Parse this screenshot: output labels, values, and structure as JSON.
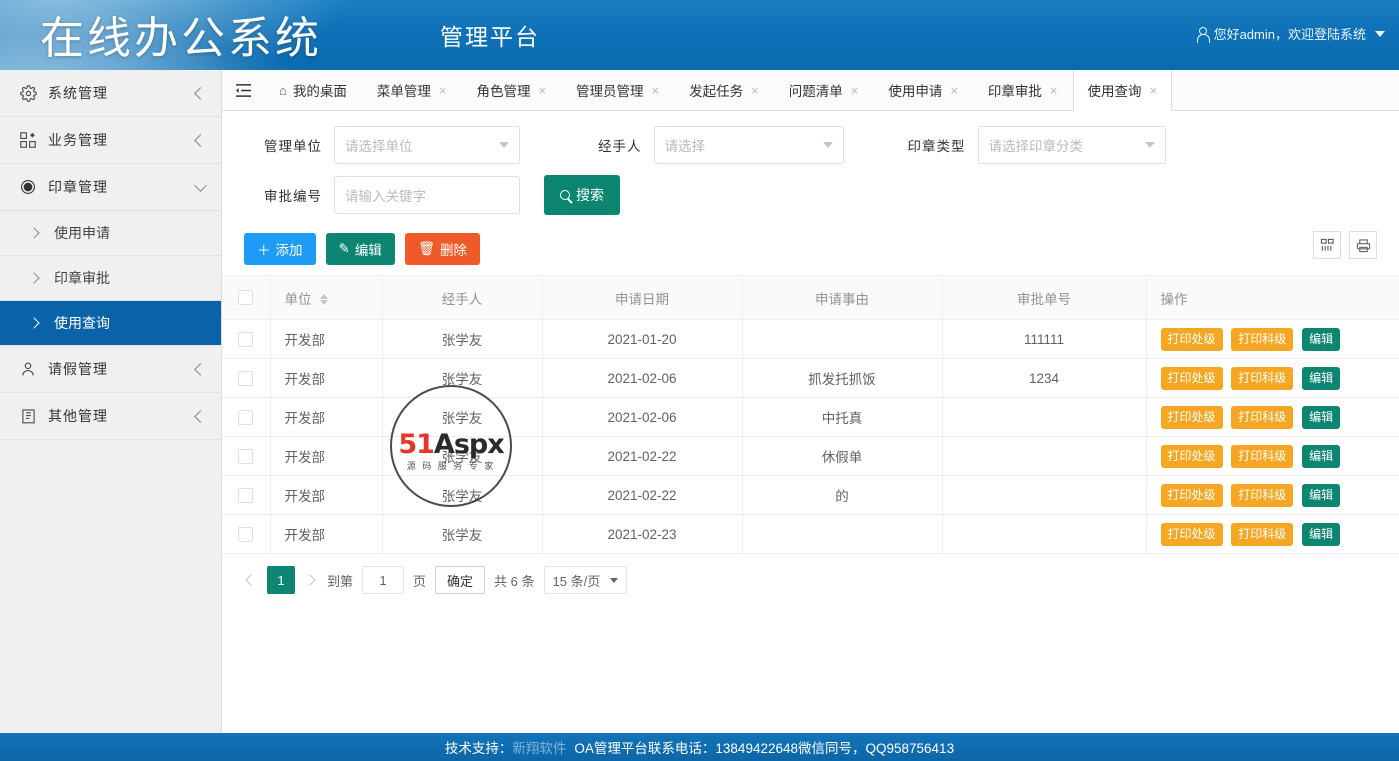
{
  "header": {
    "brand": "在线办公系统",
    "subtitle": "管理平台",
    "user_greeting": "您好admin，欢迎登陆系统",
    "user_icon": "user-icon",
    "caret_icon": "caret-down-icon"
  },
  "sidebar": {
    "items": [
      {
        "label": "系统管理",
        "icon": "gear-icon",
        "state": "collapsed"
      },
      {
        "label": "业务管理",
        "icon": "grid-icon",
        "state": "collapsed"
      },
      {
        "label": "印章管理",
        "icon": "circle-icon",
        "state": "expanded"
      }
    ],
    "sub_items": [
      {
        "label": "使用申请",
        "active": false
      },
      {
        "label": "印章审批",
        "active": false
      },
      {
        "label": "使用查询",
        "active": true
      }
    ],
    "items_after": [
      {
        "label": "请假管理",
        "icon": "person-icon",
        "state": "collapsed"
      },
      {
        "label": "其他管理",
        "icon": "clipboard-icon",
        "state": "collapsed"
      }
    ]
  },
  "tabs": {
    "toggle_icon": "menu-collapse-icon",
    "items": [
      {
        "label": "我的桌面",
        "icon": "home-icon",
        "closable": false,
        "active": false
      },
      {
        "label": "菜单管理",
        "closable": true,
        "active": false
      },
      {
        "label": "角色管理",
        "closable": true,
        "active": false
      },
      {
        "label": "管理员管理",
        "closable": true,
        "active": false
      },
      {
        "label": "发起任务",
        "closable": true,
        "active": false
      },
      {
        "label": "问题清单",
        "closable": true,
        "active": false
      },
      {
        "label": "使用申请",
        "closable": true,
        "active": false
      },
      {
        "label": "印章审批",
        "closable": true,
        "active": false
      },
      {
        "label": "使用查询",
        "closable": true,
        "active": true
      }
    ],
    "close_glyph": "×"
  },
  "search": {
    "unit_label": "管理单位",
    "unit_placeholder": "请选择单位",
    "handler_label": "经手人",
    "handler_placeholder": "请选择",
    "seal_type_label": "印章类型",
    "seal_type_placeholder": "请选择印章分类",
    "approval_no_label": "审批编号",
    "approval_no_placeholder": "请输入关键字",
    "search_button": "搜索",
    "search_icon": "search-icon"
  },
  "toolbar": {
    "add_label": "添加",
    "add_icon": "plus-icon",
    "edit_label": "编辑",
    "edit_icon": "pencil-icon",
    "delete_label": "删除",
    "delete_icon": "trash-icon",
    "columns_icon": "columns-icon",
    "print_icon": "printer-icon",
    "add_color": "#1e9bf5",
    "edit_color": "#0c8571",
    "delete_color": "#f05a28"
  },
  "table": {
    "columns": [
      "单位",
      "经手人",
      "申请日期",
      "申请事由",
      "审批单号",
      "操作"
    ],
    "sortable_column": "单位",
    "rows": [
      {
        "unit": "开发部",
        "handler": "张学友",
        "date": "2021-01-20",
        "reason": "",
        "approval_no": "111111"
      },
      {
        "unit": "开发部",
        "handler": "张学友",
        "date": "2021-02-06",
        "reason": "抓发托抓饭",
        "approval_no": "1234"
      },
      {
        "unit": "开发部",
        "handler": "张学友",
        "date": "2021-02-06",
        "reason": "中托真",
        "approval_no": ""
      },
      {
        "unit": "开发部",
        "handler": "张学友",
        "date": "2021-02-22",
        "reason": "休假单",
        "approval_no": ""
      },
      {
        "unit": "开发部",
        "handler": "张学友",
        "date": "2021-02-22",
        "reason": "的",
        "approval_no": ""
      },
      {
        "unit": "开发部",
        "handler": "张学友",
        "date": "2021-02-23",
        "reason": "",
        "approval_no": ""
      }
    ],
    "actions": [
      {
        "label": "打印处级",
        "color": "#f5a623"
      },
      {
        "label": "打印科级",
        "color": "#f5a623"
      },
      {
        "label": "编辑",
        "color": "#0c8571"
      }
    ]
  },
  "pager": {
    "prev_icon": "chevron-left-icon",
    "next_icon": "chevron-right-icon",
    "current_page": "1",
    "goto_prefix": "到第",
    "goto_value": "1",
    "goto_suffix": "页",
    "confirm_label": "确定",
    "total_text": "共 6 条",
    "page_size": "15 条/页"
  },
  "watermark": {
    "text_51": "51",
    "text_aspx": "Aspx",
    "sub": "源 码 服 务 专 家"
  },
  "footer": {
    "prefix": "技术支持：",
    "company": "新翔软件",
    "contact": "OA管理平台联系电话：13849422648微信同号，QQ958756413"
  }
}
